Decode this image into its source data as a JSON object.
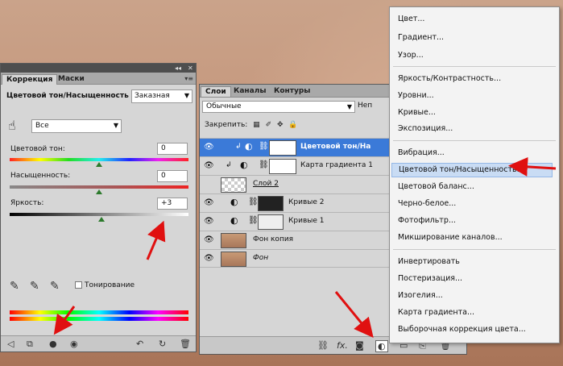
{
  "adjustments": {
    "tabs": [
      "Коррекция",
      "Маски"
    ],
    "title": "Цветовой тон/Насыщенность",
    "preset": "Заказная",
    "range": "Все",
    "hue_label": "Цветовой тон:",
    "hue_value": "0",
    "saturation_label": "Насыщенность:",
    "saturation_value": "0",
    "lightness_label": "Яркость:",
    "lightness_value": "+3",
    "colorize_label": "Тонирование"
  },
  "layers": {
    "tabs": [
      "Слои",
      "Каналы",
      "Контуры"
    ],
    "blend_mode": "Обычные",
    "opacity_label": "Неп",
    "lock_label": "Закрепить:",
    "rows": [
      {
        "name": "Цветовой тон/На"
      },
      {
        "name": "Карта градиента 1"
      },
      {
        "name": "Слой 2"
      },
      {
        "name": "Кривые 2"
      },
      {
        "name": "Кривые 1"
      },
      {
        "name": "Фон копия"
      },
      {
        "name": "Фон"
      }
    ],
    "footer_fx": "fx."
  },
  "menu": {
    "items": [
      "Цвет...",
      "Градиент...",
      "Узор...",
      "Яркость/Контрастность...",
      "Уровни...",
      "Кривые...",
      "Экспозиция...",
      "Вибрация...",
      "Цветовой тон/Насыщенность...",
      "Цветовой баланс...",
      "Черно-белое...",
      "Фотофильтр...",
      "Микширование каналов...",
      "Инвертировать",
      "Постеризация...",
      "Изогелия...",
      "Карта градиента...",
      "Выборочная коррекция цвета..."
    ],
    "highlighted": "Цветовой тон/Насыщенность..."
  },
  "colors": {
    "selection": "#3b7ad8",
    "annotation_arrow": "#e01010",
    "menu_highlight": "#c9dcf4"
  }
}
